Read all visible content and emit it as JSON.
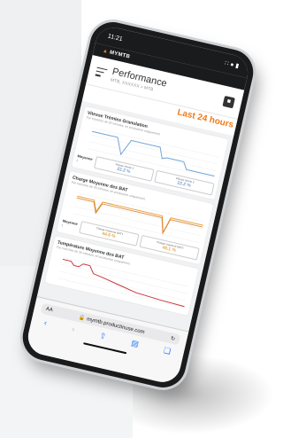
{
  "status": {
    "time": "11:21",
    "right_icons": "∷ ● ▮"
  },
  "app": {
    "logo_prefix": "",
    "logo_main": "MYMTB"
  },
  "header": {
    "title": "Performance",
    "subtitle": "MTB, XXXXXX > MTB"
  },
  "period": "Last 24 hours",
  "cards": [
    {
      "title": "Vitesse Trémies Granulation",
      "subtitle": "Par tranches de 30 minutes, en production uniquement",
      "stats_label": "Moyenne :",
      "stats": [
        {
          "label": "Vitesse trémie 1",
          "value": "22.2 %"
        },
        {
          "label": "Vitesse trémie 2",
          "value": "22.2 %"
        }
      ],
      "color": "#6fa3d8"
    },
    {
      "title": "Charge Moyenne des BAT",
      "subtitle": "Par tranches de 30 minutes, en production uniquement",
      "stats_label": "Moyenne :",
      "stats": [
        {
          "label": "Charge moyenne BAT1",
          "value": "44.6 %"
        },
        {
          "label": "Charge moyenne BAT2",
          "value": "45.1 %"
        }
      ],
      "color": "#e9a23b"
    },
    {
      "title": "Température Moyenne des BAT",
      "subtitle": "Par tranches de 30 minutes, en production uniquement",
      "color": "#c9363f"
    }
  ],
  "safari": {
    "aa": "AA",
    "url": "mymtb.productinuse.com",
    "lock_icon": "lock-icon",
    "reload_icon": "reload-icon"
  }
}
